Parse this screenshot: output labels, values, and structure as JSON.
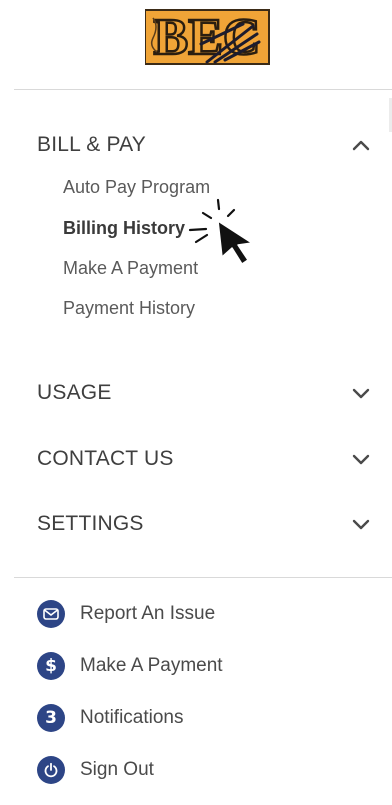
{
  "logo": {
    "text": "BEC",
    "color": "#f0a437"
  },
  "menu": {
    "sections": [
      {
        "label": "BILL & PAY",
        "expanded": true,
        "items": [
          {
            "label": "Auto Pay Program",
            "active": false
          },
          {
            "label": "Billing History",
            "active": true
          },
          {
            "label": "Make A Payment",
            "active": false
          },
          {
            "label": "Payment History",
            "active": false
          }
        ]
      },
      {
        "label": "USAGE",
        "expanded": false
      },
      {
        "label": "CONTACT US",
        "expanded": false
      },
      {
        "label": "SETTINGS",
        "expanded": false
      }
    ]
  },
  "utility": {
    "items": [
      {
        "label": "Report An Issue",
        "icon": "envelope-icon"
      },
      {
        "label": "Make A Payment",
        "icon": "dollar-icon",
        "glyph": "$"
      },
      {
        "label": "Notifications",
        "icon": "notification-badge-icon",
        "glyph": "3"
      },
      {
        "label": "Sign Out",
        "icon": "power-icon"
      }
    ]
  },
  "colors": {
    "icon_bg": "#2d4586",
    "text": "#4a4a4a",
    "divider": "#d9d9d9"
  }
}
